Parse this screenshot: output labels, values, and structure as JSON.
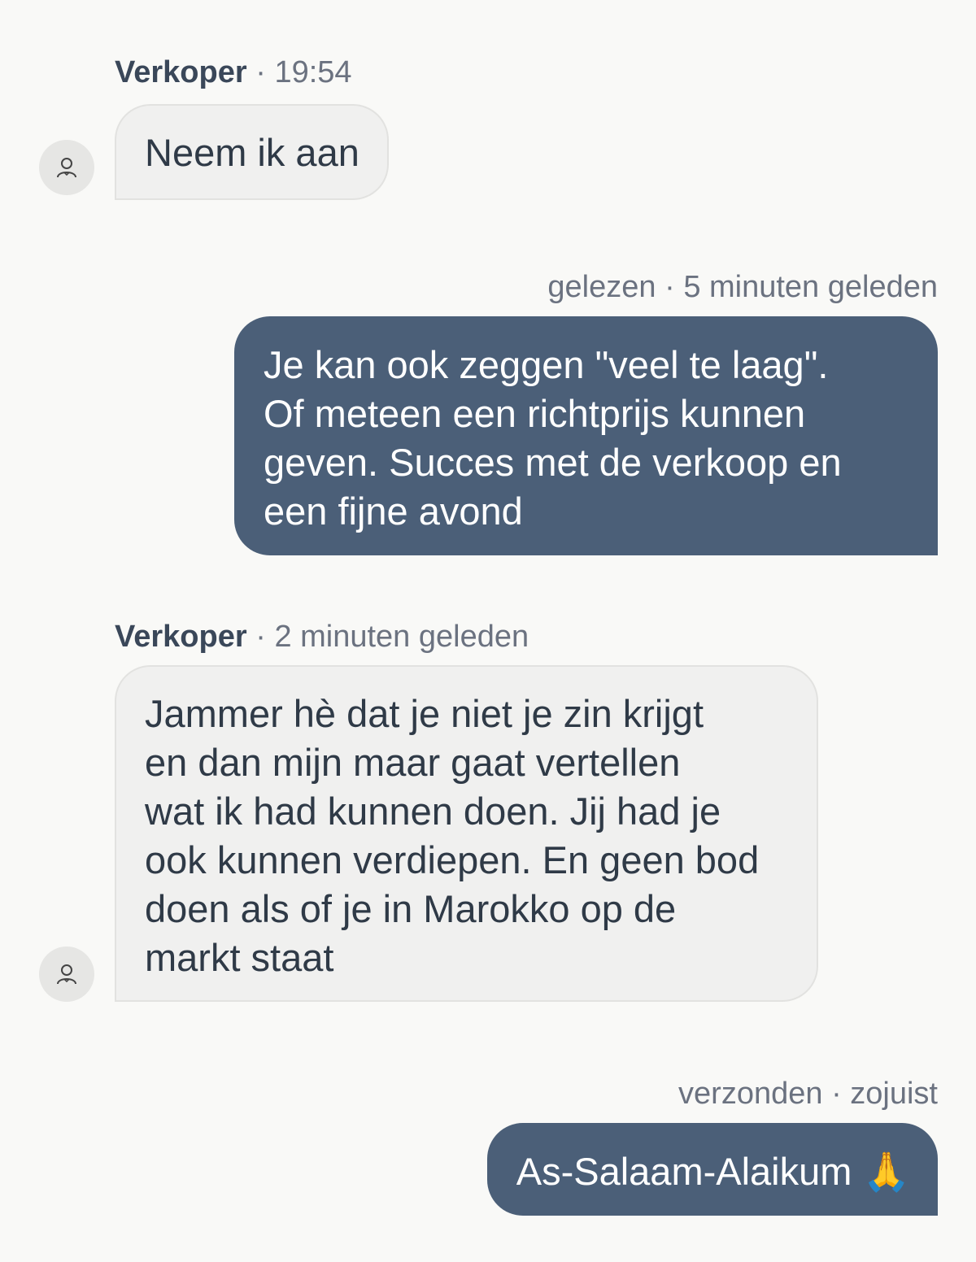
{
  "conversation": {
    "messages": [
      {
        "direction": "incoming",
        "sender": "Verkoper",
        "separator": "·",
        "time": "19:54",
        "text": "Neem ik aan",
        "avatar_icon": "user-icon"
      },
      {
        "direction": "outgoing",
        "status": "gelezen",
        "separator": "·",
        "time": "5 minuten geleden",
        "lines": [
          "Je kan ook zeggen \"veel te laag\".",
          "Of meteen een richtprijs kunnen",
          "geven. Succes met de verkoop en",
          "een fijne avond"
        ]
      },
      {
        "direction": "incoming",
        "sender": "Verkoper",
        "separator": "·",
        "time": "2 minuten geleden",
        "lines": [
          "Jammer hè dat je niet je zin krijgt",
          "en dan mijn maar gaat vertellen",
          "wat ik had kunnen doen. Jij had je",
          "ook kunnen verdiepen. En geen bod",
          "doen als of je in Marokko op de",
          "markt staat"
        ],
        "avatar_icon": "user-icon"
      },
      {
        "direction": "outgoing",
        "status": "verzonden",
        "separator": "·",
        "time": "zojuist",
        "text": "As-Salaam-Alaikum 🙏"
      }
    ]
  },
  "colors": {
    "background": "#f9f9f7",
    "incoming_bubble": "#f0f0ef",
    "outgoing_bubble": "#4b5f78",
    "incoming_text": "#2f3a47",
    "outgoing_text": "#ffffff",
    "meta_text": "#6b7280",
    "sender_text": "#3a4759"
  }
}
